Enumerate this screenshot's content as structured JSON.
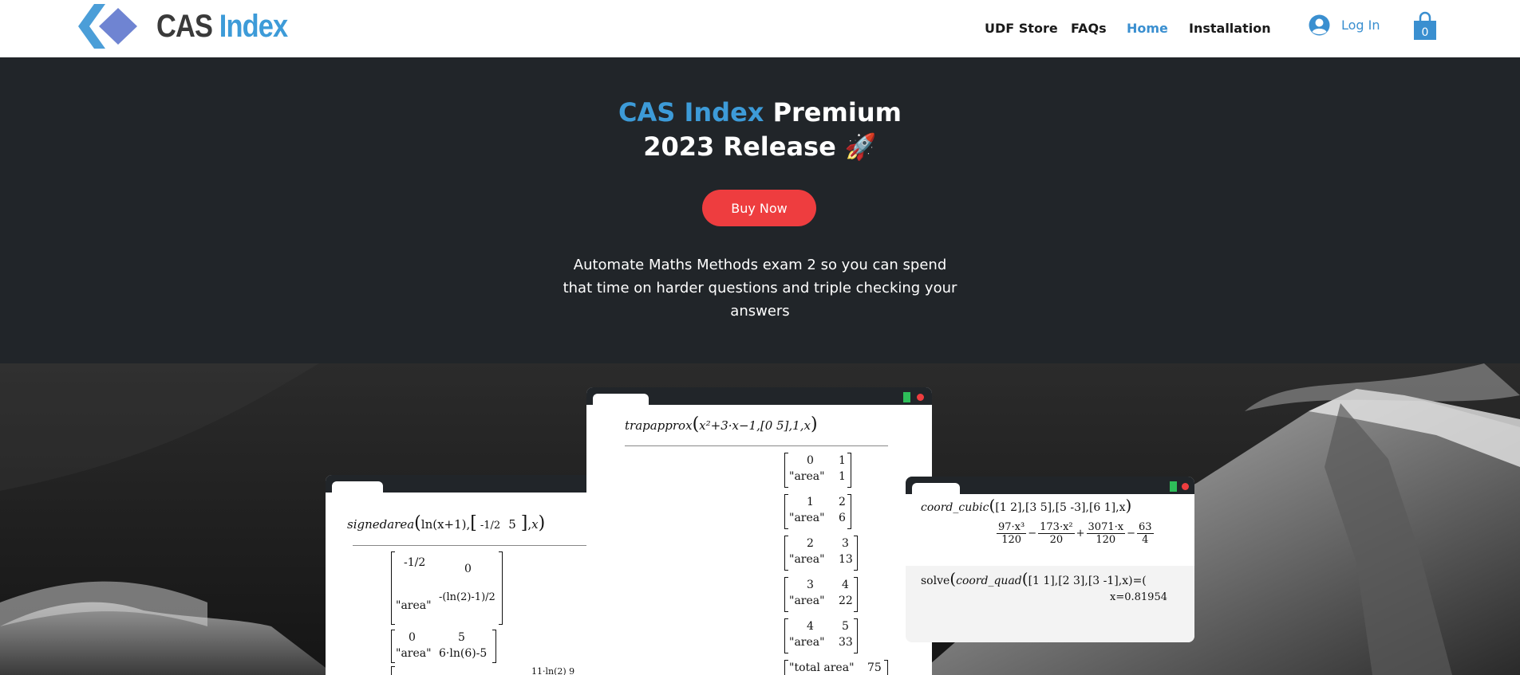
{
  "header": {
    "brand_part1": "CAS",
    "brand_part2": "Index",
    "nav": [
      {
        "label": "UDF Store",
        "active": false
      },
      {
        "label": "FAQs",
        "active": false
      },
      {
        "label": "Home",
        "active": true
      },
      {
        "label": "Installation",
        "active": false
      }
    ],
    "login_label": "Log In",
    "cart_count": "0",
    "icons": {
      "login": "user-icon",
      "cart": "shopping-bag-icon",
      "logo": "diamond-logo-icon"
    }
  },
  "hero": {
    "title_blue": "CAS Index",
    "title_white": " Premium",
    "title_line2": "2023 Release",
    "title_emoji": "🚀",
    "buy_button": "Buy Now",
    "description": "Automate Maths Methods exam 2 so you can spend that time on harder questions and triple checking your answers"
  },
  "windows": {
    "left": {
      "command_fn": "signedarea",
      "command_arg": "ln(x+1),",
      "command_tail": "x",
      "matrix_rows": [
        {
          "a": "-1/2",
          "b": "0"
        },
        {
          "a": "\"area\"",
          "b": "-(ln(2)-1)/2"
        },
        {
          "a": "0",
          "b": "5"
        },
        {
          "a": "\"area\"",
          "b": "6·ln(6)-5"
        }
      ],
      "vector": [
        "-1/2",
        "5"
      ],
      "partial_tail": "11·ln(2)   9"
    },
    "center": {
      "command_fn": "trapapprox",
      "command_expr": "x²+3·x−1,[0  5],1,x",
      "matrices": [
        {
          "r1": [
            "0",
            "1"
          ],
          "r2": [
            "\"area\"",
            "1"
          ]
        },
        {
          "r1": [
            "1",
            "2"
          ],
          "r2": [
            "\"area\"",
            "6"
          ]
        },
        {
          "r1": [
            "2",
            "3"
          ],
          "r2": [
            "\"area\"",
            "13"
          ]
        },
        {
          "r1": [
            "3",
            "4"
          ],
          "r2": [
            "\"area\"",
            "22"
          ]
        },
        {
          "r1": [
            "4",
            "5"
          ],
          "r2": [
            "\"area\"",
            "33"
          ]
        }
      ],
      "total_label": "\"total area\"",
      "total_value": "75"
    },
    "right": {
      "command1_fn": "coord_cubic",
      "command1_args": "[1  2],[3  5],[5  -3],[6  1],x",
      "result_terms": [
        {
          "num": "97·x³",
          "den": "120",
          "sign": ""
        },
        {
          "num": "173·x²",
          "den": "20",
          "sign": "−"
        },
        {
          "num": "3071·x",
          "den": "120",
          "sign": "+"
        },
        {
          "num": "63",
          "den": "4",
          "sign": "−"
        }
      ],
      "command2_prefix": "solve",
      "command2_fn": "coord_quad",
      "command2_args": "[1  1],[2  3],[3  -1],x",
      "command2_tail": ")=(",
      "result2": "x=0.81954"
    }
  },
  "colors": {
    "brand_blue": "#3d9bd8",
    "hero_bg": "#212529",
    "buy_button": "#ee3d3f",
    "nav_active": "#3a8fd0"
  }
}
